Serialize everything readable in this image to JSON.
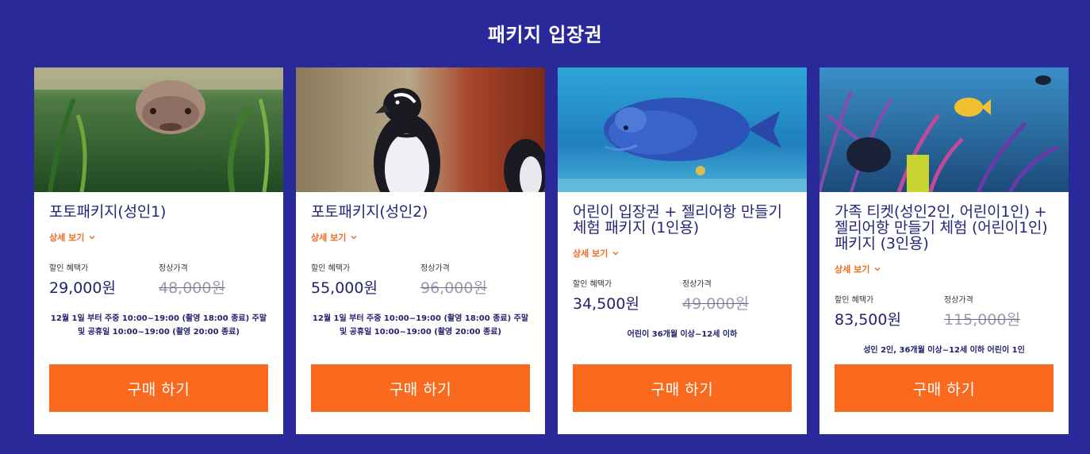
{
  "section_title": "패키지 입장권",
  "detail_label": "상세 보기",
  "sale_label": "할인 혜택가",
  "orig_label": "정상가격",
  "buy_label": "구매 하기",
  "cards": [
    {
      "title": "포토패키지(성인1)",
      "sale_price": "29,000원",
      "orig_price": "48,000원",
      "note": "12월 1일 부터 주중 10:00~19:00 (촬영 18:00 종료) 주말 및 공휴일 10:00~19:00 (촬영 20:00 종료)",
      "image": "fish-underwater-icon"
    },
    {
      "title": "포토패키지(성인2)",
      "sale_price": "55,000원",
      "orig_price": "96,000원",
      "note": "12월 1일 부터 주중 10:00~19:00 (촬영 18:00 종료) 주말 및 공휴일 10:00~19:00 (촬영 20:00 종료)",
      "image": "penguin-icon"
    },
    {
      "title": "어린이 입장권 + 젤리어항 만들기 체험 패키지 (1인용)",
      "sale_price": "34,500원",
      "orig_price": "49,000원",
      "note": "어린이 36개월 이상~12세 이하",
      "image": "blue-fish-icon"
    },
    {
      "title": "가족 티켓(성인2인, 어린이1인) + 젤리어항 만들기 체험 (어린이1인) 패키지 (3인용)",
      "sale_price": "83,500원",
      "orig_price": "115,000원",
      "note": "성인 2인, 36개월 이상~12세 이하 어린이 1인",
      "image": "coral-reef-icon"
    }
  ],
  "colors": {
    "background": "#29299a",
    "accent": "#f96a1e",
    "text": "#22226e"
  }
}
